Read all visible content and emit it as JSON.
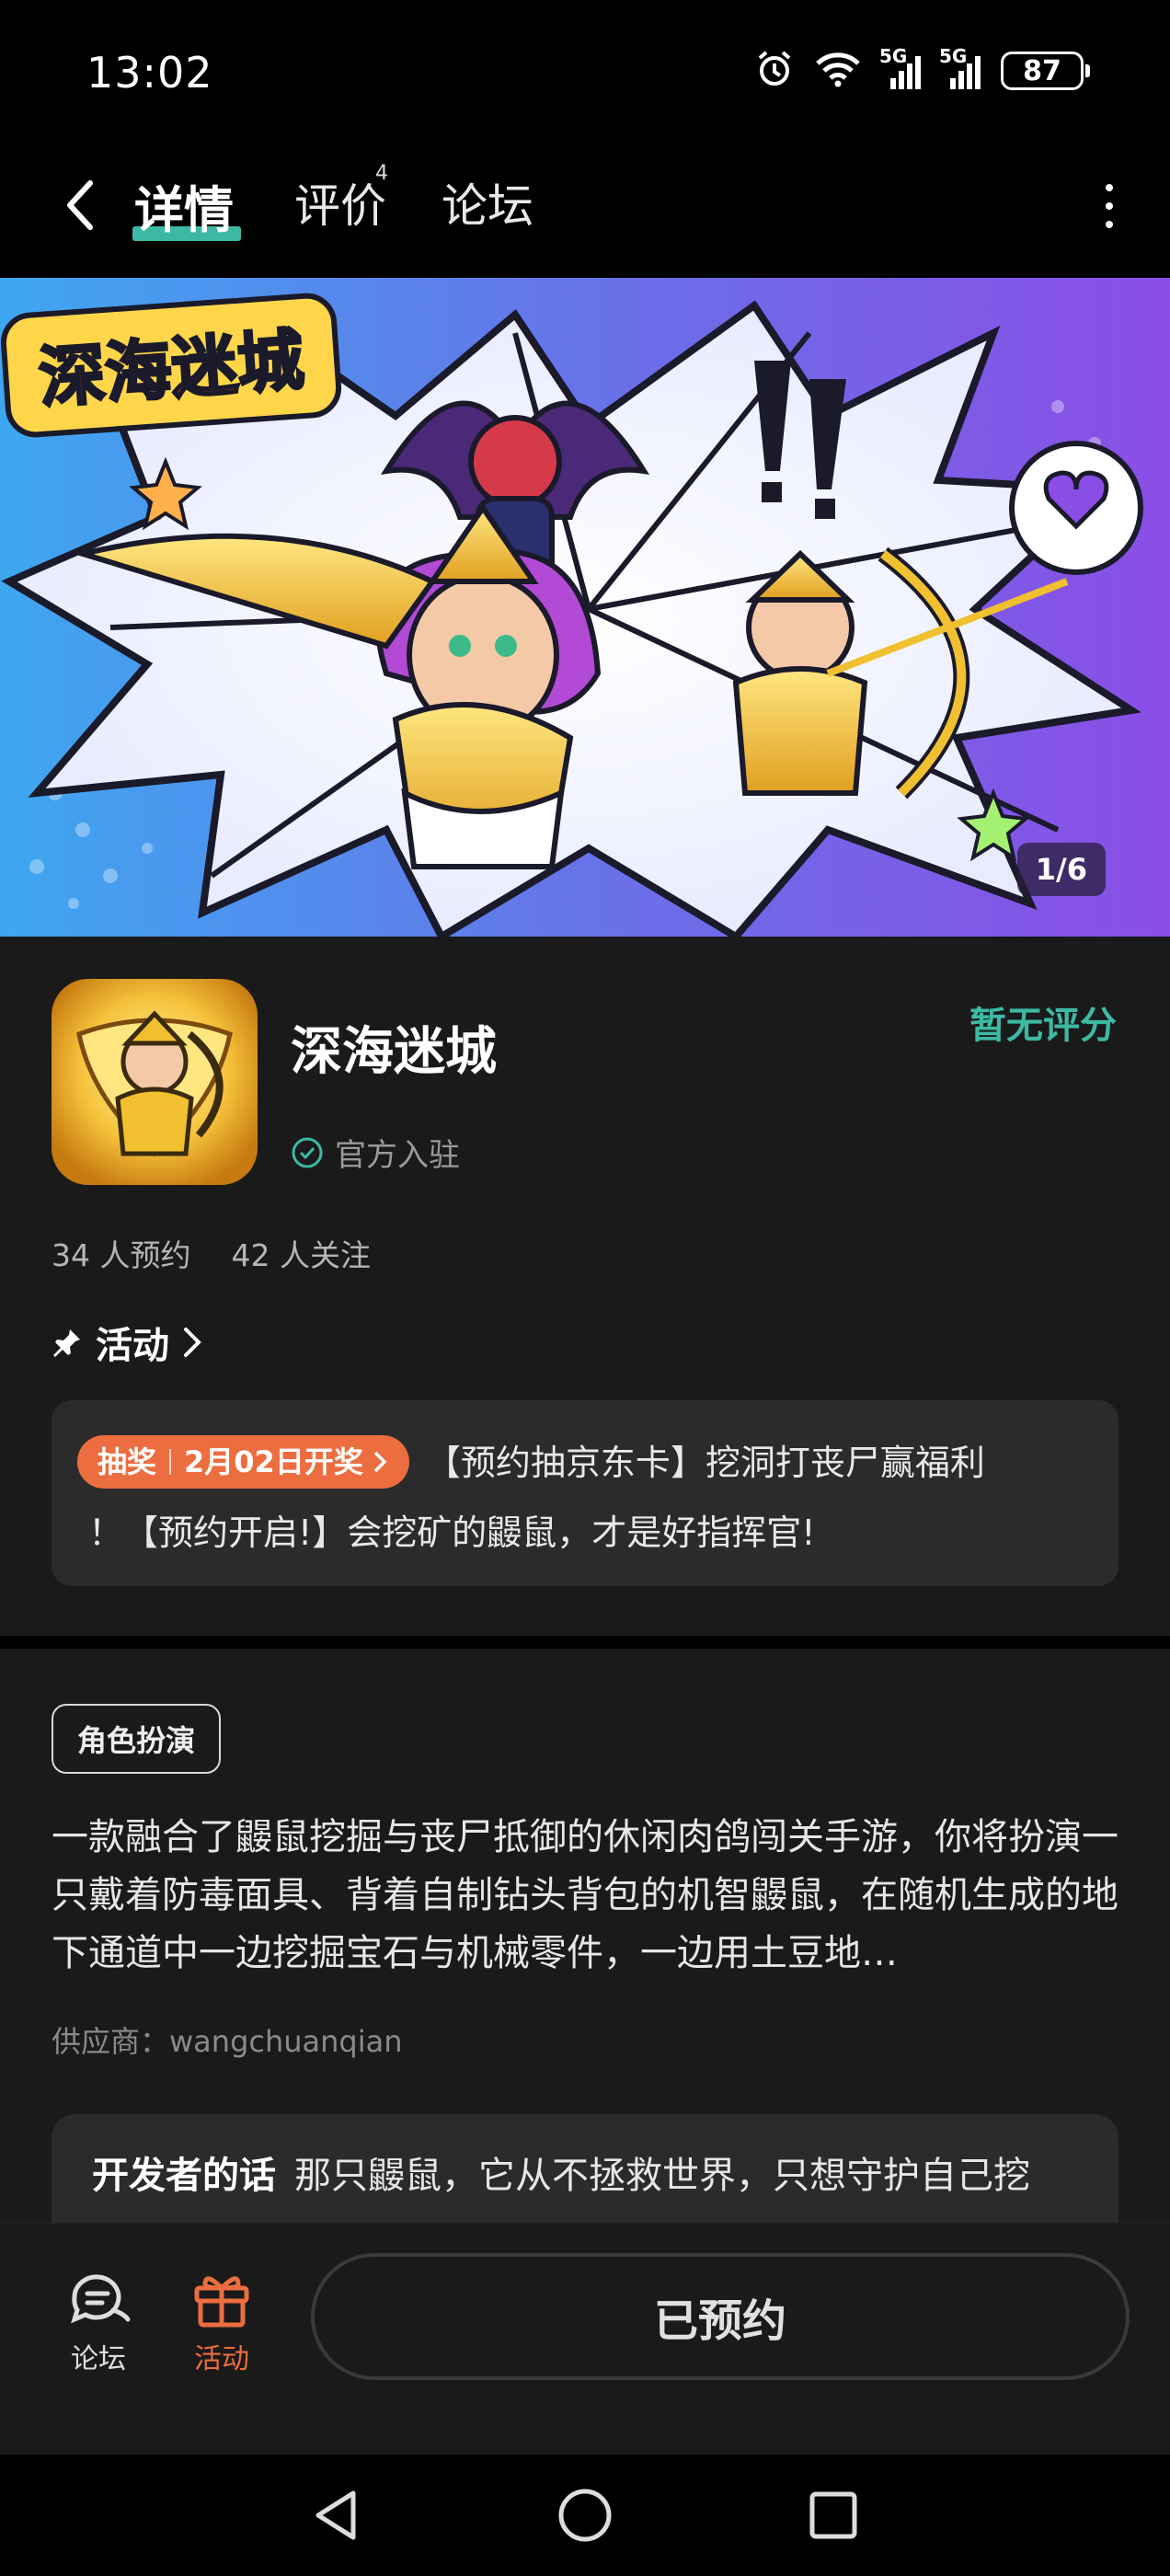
{
  "status_bar": {
    "time": "13:02",
    "network_1": "5G",
    "network_2": "5G",
    "battery": "87",
    "icons": [
      "alarm-icon",
      "wifi-icon",
      "signal-icon",
      "signal-icon",
      "battery-icon"
    ]
  },
  "nav": {
    "tabs": [
      {
        "label": "详情",
        "active": true
      },
      {
        "label": "评价",
        "badge": "4"
      },
      {
        "label": "论坛"
      }
    ],
    "back_icon": "back-arrow-icon",
    "more_icon": "more-vertical-icon"
  },
  "banner": {
    "counter": "1/6",
    "logo_text": "深海迷城"
  },
  "app": {
    "name": "深海迷城",
    "rating": "暂无评分",
    "official": "官方入驻",
    "reservations": "34 人预约",
    "followers": "42 人关注"
  },
  "activity": {
    "heading": "活动",
    "tag_left": "抽奖",
    "tag_right": "2月02日开奖",
    "line1": "【预约抽京东卡】挖洞打丧尸赢福利",
    "line2": "！【预约开启!】会挖矿的鼹鼠，才是好指挥官!"
  },
  "details": {
    "genre": "角色扮演",
    "description": "一款融合了鼹鼠挖掘与丧尸抵御的休闲肉鸽闯关手游，你将扮演一只戴着防毒面具、背着自制钻头背包的机智鼹鼠，在随机生成的地下通道中一边挖掘宝石与机械零件，一边用土豆地…",
    "supplier": "供应商：wangchuanqian",
    "dev_label": "开发者的话",
    "dev_text": "那只鼹鼠，它从不拯救世界，只想守护自己挖"
  },
  "bottom_bar": {
    "forum": "论坛",
    "activity": "活动",
    "reserved": "已预约",
    "accent": "#ec6d3f"
  },
  "colors": {
    "teal": "#3db9a3",
    "orange": "#ec6d3f",
    "background": "#1a1a1a"
  }
}
